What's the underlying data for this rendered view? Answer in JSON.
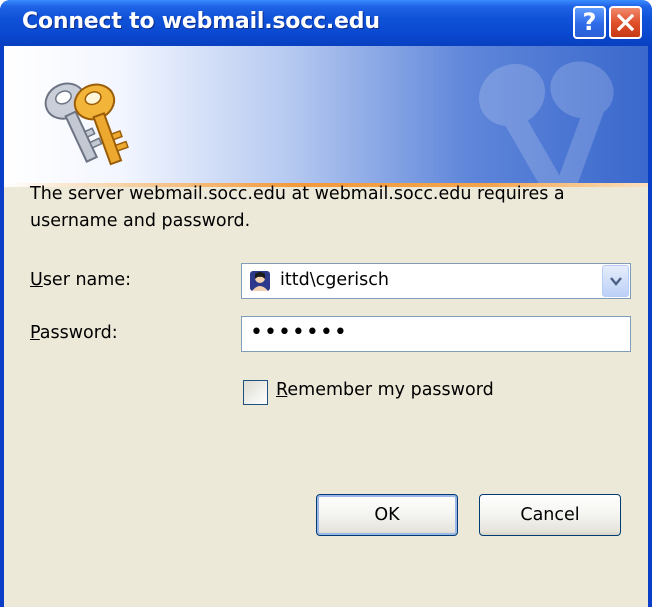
{
  "window": {
    "title": "Connect to webmail.socc.edu",
    "help_label": "?",
    "close_icon": "close-icon"
  },
  "banner": {
    "icon": "keys-icon",
    "watermark_icon": "keys-watermark-icon"
  },
  "message": "The server webmail.socc.edu at webmail.socc.edu requires a username and password.",
  "username": {
    "label_mnemonic": "U",
    "label_rest": "ser name:",
    "value": "ittd\\cgerisch",
    "icon": "user-icon"
  },
  "password": {
    "label_mnemonic": "P",
    "label_rest": "assword:",
    "value": "•••••••"
  },
  "remember": {
    "label_mnemonic": "R",
    "label_rest": "emember my password",
    "checked": false
  },
  "buttons": {
    "ok": "OK",
    "cancel": "Cancel"
  },
  "colors": {
    "titlebar": "#0a48d0",
    "face": "#ece9d8",
    "accent_orange": "#f39a3a",
    "field_border": "#7f9db9"
  }
}
